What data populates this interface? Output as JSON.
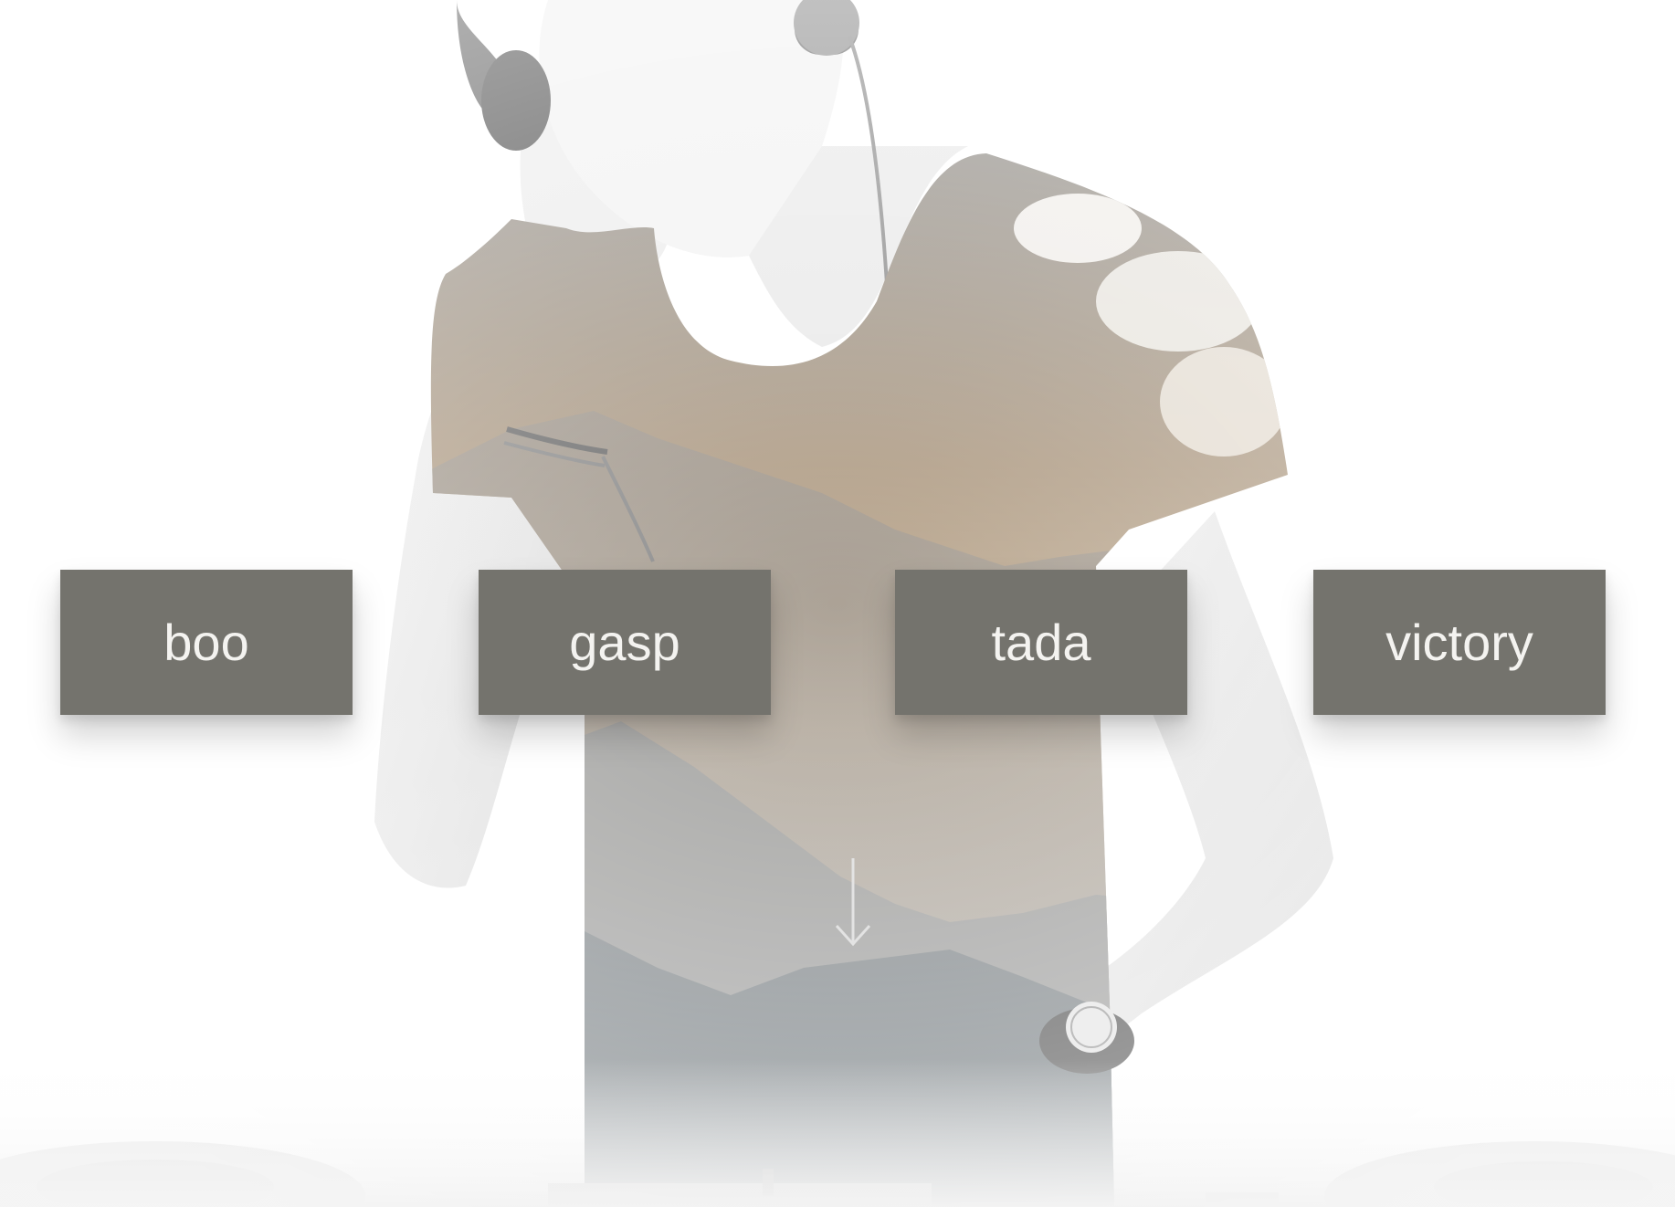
{
  "hero": {
    "image": "dj-with-headphones-double-exposure-photo"
  },
  "colors": {
    "button_background": "#74736d",
    "button_text": "#f4f3f0",
    "page_background": "#ffffff"
  },
  "sound_buttons": [
    {
      "label": "boo"
    },
    {
      "label": "gasp"
    },
    {
      "label": "tada"
    },
    {
      "label": "victory"
    }
  ],
  "scroll_indicator": {
    "icon": "arrow-down-icon"
  }
}
